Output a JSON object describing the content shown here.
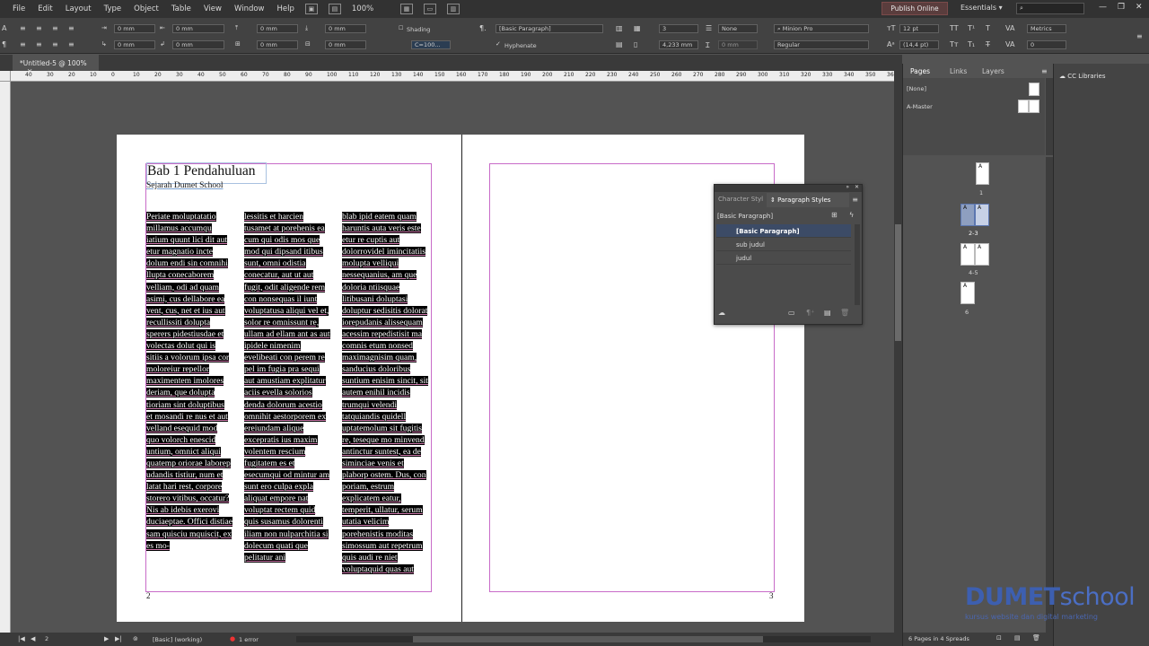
{
  "menubar": {
    "items": [
      "File",
      "Edit",
      "Layout",
      "Type",
      "Object",
      "Table",
      "View",
      "Window",
      "Help"
    ],
    "zoom": "100%",
    "publish": "Publish Online",
    "workspace": "Essentials"
  },
  "control": {
    "indent_values": [
      "0 mm",
      "0 mm",
      "0 mm",
      "0 mm",
      "0 mm",
      "0 mm",
      "0 mm",
      "0 mm"
    ],
    "shading_label": "Shading",
    "hyphenate_label": "Hyphenate",
    "shading_color": "C=100...",
    "paragraph_style": "[Basic Paragraph]",
    "columns_value": "3",
    "gutter_value": "4,233 mm",
    "span_value": "0 mm",
    "none_value": "None",
    "font_family": "Minion Pro",
    "font_style": "Regular",
    "font_size": "12 pt",
    "leading": "(14,4 pt)",
    "kerning": "Metrics",
    "tracking": "0"
  },
  "document": {
    "tab_title": "*Untitled-5 @ 100%"
  },
  "ruler": {
    "h_labels": [
      "40",
      "30",
      "20",
      "10",
      "0",
      "10",
      "20",
      "30",
      "40",
      "50",
      "60",
      "70",
      "80",
      "90",
      "100",
      "110",
      "120",
      "130",
      "140",
      "150",
      "160",
      "170",
      "180",
      "190",
      "200",
      "210",
      "220",
      "230",
      "240",
      "250",
      "260",
      "270",
      "280",
      "290",
      "300",
      "310",
      "320",
      "330",
      "340",
      "350",
      "360",
      "370",
      "380"
    ]
  },
  "page_left": {
    "title": "Bab 1 Pendahuluan",
    "subtitle": "Sejarah Dumet School",
    "col1": "Periate moluptatatio millamus accumqu iatium quunt lici dit aut etur magnatio incte dolum endi sin comnihi llupta conecaborem velliam, odi ad quam asimi, cus dellabore ea vent, cus, net et ius aut recullissiti dolupta sperers pidestiusdae et volectas dolut qui is sitiis a volorum ipsa cor moloreiur repellor maximentem imolores deriam, que dolupta tioriam sint doluptibus et mosandi re nus et aut velland esequid mod quo volorch enescid untium, omnict aliqui quatemp oriorae laborep udandis tistiur, num et latat hari rest, corpore storero vitibus, occatur? Nis ab idebis exerovi duciaeptae. Offici distiae sam quisciu mquiscit, ex es mo-",
    "col2": "lessitis et harcien tusamet at porehenis ea cum qui odis mos que mod qui dipsand itibus sunt, omni odistia conecatur, aut ut aut fugit, odit aligende rem con nonsequas il iunt voluptatusa aliqui vel et, solor re omnissunt re, ullam ad ellam ant as aut ipidele nimenim evelibeati con perem re pel im fugia pra sequi aut amustiam explitatur aciis evella solorios denda dolorum acestio omnihit aestorporem ex ereiundam alique excepratis ius maxim volentem rescium fugitatem es et esecumqui od mintur am sunt ero culpa expla aliquat empore nat voluptat rectem quid quis susamus dolorenti iliam non nulparchitia si dolecum quati que pelitatur ani",
    "col3": "blab ipid eatem quam haruntis auta veris este etur re cuptis aut dolorrovidel imincitatiis molupta velliqui nessequanius, am que doloria ntiisquae litibusani doluptasi doluptur sedisitis dolorat iorepudanis alissequam acessim repedistisit ma comnis etum nonsed maximagnisim quam, sanducius doloribus suntium enisim sincit, sit autem enihil incidis trumqui velendi tatquiandis quidell uptatemolum sit fugitis re, teseque mo minvend antinctur suntest, ea de siminciae venis et plaborp ostem. Dus, con poriam, estrum explicatem eatur, temperit, ullatur, serum utatia velicim porehenistis moditas simossum aut repetrum quis audi re niet voluptaquid quas aut",
    "page_number": "2"
  },
  "page_right": {
    "page_number": "3"
  },
  "styles_panel": {
    "tab_inactive": "Character Styl",
    "tab_active": "Paragraph Styles",
    "current": "[Basic Paragraph]",
    "items": [
      "[Basic Paragraph]",
      "sub judul",
      "judul"
    ]
  },
  "pages_panel": {
    "tabs": [
      "Pages",
      "Links",
      "Layers"
    ],
    "masters": [
      "[None]",
      "A-Master"
    ],
    "page_labels": [
      "1",
      "2-3",
      "4-5",
      "6"
    ],
    "status": "6 Pages in 4 Spreads",
    "master_letter": "A"
  },
  "cc_libraries": {
    "title": "CC Libraries"
  },
  "statusbar": {
    "page": "2",
    "style": "[Basic] (working)",
    "errors": "1 error"
  },
  "watermark": {
    "brand": "DUMET",
    "brand2": "school",
    "tagline": "kursus website dan digital marketing"
  },
  "colors": {
    "frame_margin": "#c86bc8",
    "selection": "#000000",
    "publish_bg": "#5a3d3d",
    "active_style_row": "#3c4b66"
  }
}
